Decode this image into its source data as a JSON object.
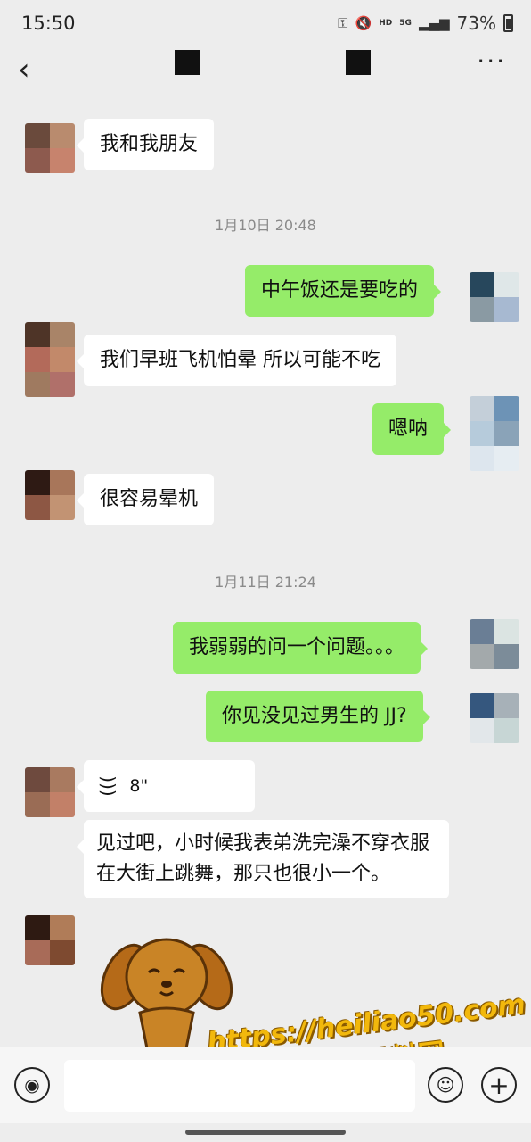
{
  "status_bar": {
    "time": "15:50",
    "network_top": "5G",
    "hd": "HD",
    "battery": "73%"
  },
  "nav": {
    "back_icon": "chevron-left-icon",
    "more_icon": "more-dots-icon"
  },
  "messages": [
    {
      "side": "left",
      "text": "我和我朋友"
    },
    {
      "type": "time",
      "text": "1月10日 20:48"
    },
    {
      "side": "right",
      "text": "中午饭还是要吃的"
    },
    {
      "side": "left",
      "text": "我们早班飞机怕晕 所以可能不吃"
    },
    {
      "side": "right",
      "text": "嗯呐"
    },
    {
      "side": "left",
      "text": "很容易晕机"
    },
    {
      "type": "time",
      "text": "1月11日 21:24"
    },
    {
      "side": "right",
      "text": "我弱弱的问一个问题。。。"
    },
    {
      "side": "right",
      "text": "你见没见过男生的 JJ?"
    },
    {
      "side": "left",
      "type": "voice",
      "duration": "8\""
    },
    {
      "side": "left",
      "text": "见过吧，小时候我表弟洗完澡不穿衣服在大街上跳舞，那只也很小一个。"
    },
    {
      "side": "left",
      "type": "sticker",
      "icon": "dog-sticker-icon"
    }
  ],
  "input_bar": {
    "voice_icon": "voice-mode-icon",
    "emoji_icon": "emoji-icon",
    "plus_icon": "plus-icon"
  },
  "watermark": {
    "line1": "https://heiliao50.com",
    "line2": "黑料网"
  },
  "colors": {
    "background": "#ededed",
    "bubble_right": "#95ec69",
    "bubble_left": "#ffffff"
  }
}
